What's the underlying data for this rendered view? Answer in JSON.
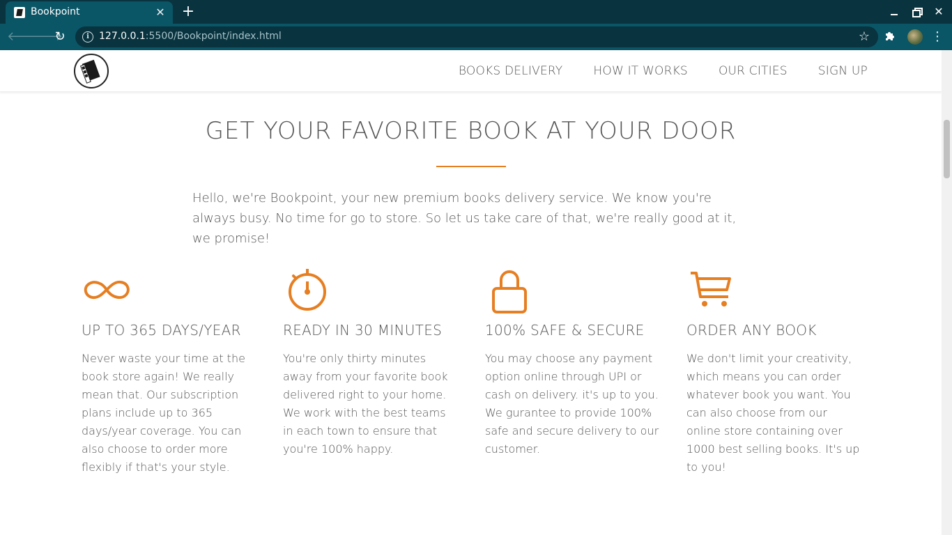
{
  "browser": {
    "tab_title": "Bookpoint",
    "tab_close_glyph": "✕",
    "new_tab_glyph": "+",
    "url_host": "127.0.0.1",
    "url_rest": ":5500/Bookpoint/index.html",
    "icons": {
      "back": "back-arrow-icon",
      "forward": "forward-arrow-icon",
      "reload": "reload-icon",
      "info": "info-icon",
      "star": "bookmark-star-icon",
      "extensions": "puzzle-icon",
      "menu": "kebab-menu-icon"
    },
    "colors": {
      "tabbar": "#08333f",
      "toolbar": "#0a5566"
    }
  },
  "nav": {
    "links": [
      "BOOKS DELIVERY",
      "HOW IT WORKS",
      "OUR CITIES",
      "SIGN UP"
    ]
  },
  "main": {
    "heading": "GET YOUR FAVORITE BOOK AT YOUR DOOR",
    "intro": "Hello, we're Bookpoint, your new premium books delivery service. We know you're always busy. No time for go to store. So let us take care of that, we're really good at it, we promise!",
    "accent_color": "#e67e22",
    "features": [
      {
        "icon": "infinity-icon",
        "title": "Up to 365 days/year",
        "text": "Never waste your time at the book store again! We really mean that. Our subscription plans include up to 365 days/year coverage. You can also choose to order more flexibly if that's your style."
      },
      {
        "icon": "stopwatch-icon",
        "title": "Ready in 30 minutes",
        "text": "You're only thirty minutes away from your favorite book delivered right to your home. We work with the best teams in each town to ensure that you're 100% happy."
      },
      {
        "icon": "lock-icon",
        "title": "100% safe & secure",
        "text": "You may choose any payment option online through UPI or cash on delivery. it's up to you. We gurantee to provide 100% safe and secure delivery to our customer."
      },
      {
        "icon": "cart-icon",
        "title": "Order any book",
        "text": "We don't limit your creativity, which means you can order whatever book you want. You can also choose from our online store containing over 1000 best selling books. It's up to you!"
      }
    ]
  }
}
